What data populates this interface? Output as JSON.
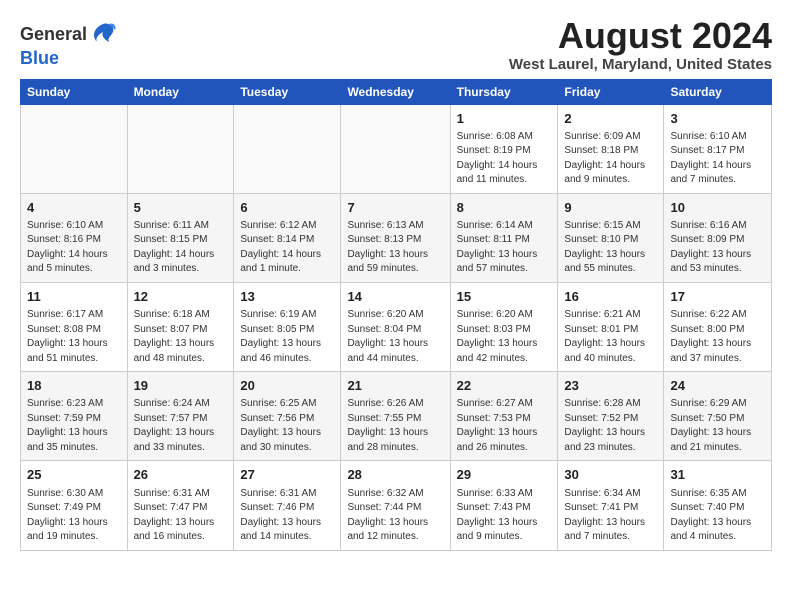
{
  "logo": {
    "general": "General",
    "blue": "Blue"
  },
  "title": "August 2024",
  "location": "West Laurel, Maryland, United States",
  "days_of_week": [
    "Sunday",
    "Monday",
    "Tuesday",
    "Wednesday",
    "Thursday",
    "Friday",
    "Saturday"
  ],
  "weeks": [
    [
      {
        "day": "",
        "content": ""
      },
      {
        "day": "",
        "content": ""
      },
      {
        "day": "",
        "content": ""
      },
      {
        "day": "",
        "content": ""
      },
      {
        "day": "1",
        "content": "Sunrise: 6:08 AM\nSunset: 8:19 PM\nDaylight: 14 hours\nand 11 minutes."
      },
      {
        "day": "2",
        "content": "Sunrise: 6:09 AM\nSunset: 8:18 PM\nDaylight: 14 hours\nand 9 minutes."
      },
      {
        "day": "3",
        "content": "Sunrise: 6:10 AM\nSunset: 8:17 PM\nDaylight: 14 hours\nand 7 minutes."
      }
    ],
    [
      {
        "day": "4",
        "content": "Sunrise: 6:10 AM\nSunset: 8:16 PM\nDaylight: 14 hours\nand 5 minutes."
      },
      {
        "day": "5",
        "content": "Sunrise: 6:11 AM\nSunset: 8:15 PM\nDaylight: 14 hours\nand 3 minutes."
      },
      {
        "day": "6",
        "content": "Sunrise: 6:12 AM\nSunset: 8:14 PM\nDaylight: 14 hours\nand 1 minute."
      },
      {
        "day": "7",
        "content": "Sunrise: 6:13 AM\nSunset: 8:13 PM\nDaylight: 13 hours\nand 59 minutes."
      },
      {
        "day": "8",
        "content": "Sunrise: 6:14 AM\nSunset: 8:11 PM\nDaylight: 13 hours\nand 57 minutes."
      },
      {
        "day": "9",
        "content": "Sunrise: 6:15 AM\nSunset: 8:10 PM\nDaylight: 13 hours\nand 55 minutes."
      },
      {
        "day": "10",
        "content": "Sunrise: 6:16 AM\nSunset: 8:09 PM\nDaylight: 13 hours\nand 53 minutes."
      }
    ],
    [
      {
        "day": "11",
        "content": "Sunrise: 6:17 AM\nSunset: 8:08 PM\nDaylight: 13 hours\nand 51 minutes."
      },
      {
        "day": "12",
        "content": "Sunrise: 6:18 AM\nSunset: 8:07 PM\nDaylight: 13 hours\nand 48 minutes."
      },
      {
        "day": "13",
        "content": "Sunrise: 6:19 AM\nSunset: 8:05 PM\nDaylight: 13 hours\nand 46 minutes."
      },
      {
        "day": "14",
        "content": "Sunrise: 6:20 AM\nSunset: 8:04 PM\nDaylight: 13 hours\nand 44 minutes."
      },
      {
        "day": "15",
        "content": "Sunrise: 6:20 AM\nSunset: 8:03 PM\nDaylight: 13 hours\nand 42 minutes."
      },
      {
        "day": "16",
        "content": "Sunrise: 6:21 AM\nSunset: 8:01 PM\nDaylight: 13 hours\nand 40 minutes."
      },
      {
        "day": "17",
        "content": "Sunrise: 6:22 AM\nSunset: 8:00 PM\nDaylight: 13 hours\nand 37 minutes."
      }
    ],
    [
      {
        "day": "18",
        "content": "Sunrise: 6:23 AM\nSunset: 7:59 PM\nDaylight: 13 hours\nand 35 minutes."
      },
      {
        "day": "19",
        "content": "Sunrise: 6:24 AM\nSunset: 7:57 PM\nDaylight: 13 hours\nand 33 minutes."
      },
      {
        "day": "20",
        "content": "Sunrise: 6:25 AM\nSunset: 7:56 PM\nDaylight: 13 hours\nand 30 minutes."
      },
      {
        "day": "21",
        "content": "Sunrise: 6:26 AM\nSunset: 7:55 PM\nDaylight: 13 hours\nand 28 minutes."
      },
      {
        "day": "22",
        "content": "Sunrise: 6:27 AM\nSunset: 7:53 PM\nDaylight: 13 hours\nand 26 minutes."
      },
      {
        "day": "23",
        "content": "Sunrise: 6:28 AM\nSunset: 7:52 PM\nDaylight: 13 hours\nand 23 minutes."
      },
      {
        "day": "24",
        "content": "Sunrise: 6:29 AM\nSunset: 7:50 PM\nDaylight: 13 hours\nand 21 minutes."
      }
    ],
    [
      {
        "day": "25",
        "content": "Sunrise: 6:30 AM\nSunset: 7:49 PM\nDaylight: 13 hours\nand 19 minutes."
      },
      {
        "day": "26",
        "content": "Sunrise: 6:31 AM\nSunset: 7:47 PM\nDaylight: 13 hours\nand 16 minutes."
      },
      {
        "day": "27",
        "content": "Sunrise: 6:31 AM\nSunset: 7:46 PM\nDaylight: 13 hours\nand 14 minutes."
      },
      {
        "day": "28",
        "content": "Sunrise: 6:32 AM\nSunset: 7:44 PM\nDaylight: 13 hours\nand 12 minutes."
      },
      {
        "day": "29",
        "content": "Sunrise: 6:33 AM\nSunset: 7:43 PM\nDaylight: 13 hours\nand 9 minutes."
      },
      {
        "day": "30",
        "content": "Sunrise: 6:34 AM\nSunset: 7:41 PM\nDaylight: 13 hours\nand 7 minutes."
      },
      {
        "day": "31",
        "content": "Sunrise: 6:35 AM\nSunset: 7:40 PM\nDaylight: 13 hours\nand 4 minutes."
      }
    ]
  ]
}
